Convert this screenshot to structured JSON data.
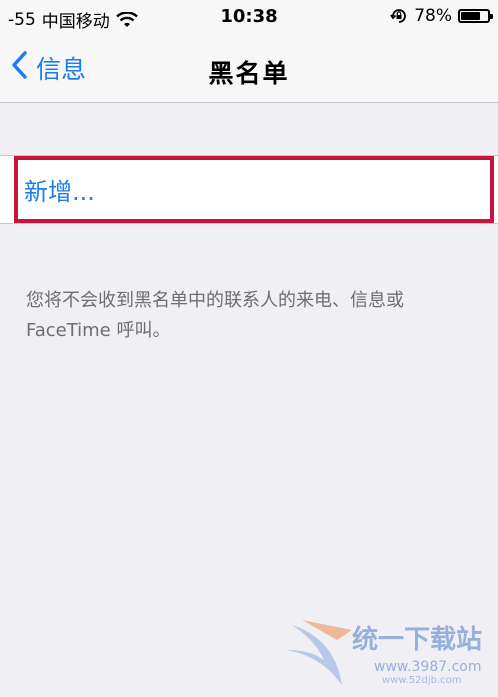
{
  "status_bar": {
    "signal": "-55",
    "carrier": "中国移动",
    "time": "10:38",
    "battery_percent": "78%",
    "battery_level": 0.78,
    "icons": [
      "wifi-icon",
      "rotation-lock-icon",
      "battery-icon"
    ]
  },
  "nav": {
    "back_label": "信息",
    "title": "黑名单",
    "accent_color": "#1a7cf2"
  },
  "list": {
    "add_label": "新增..."
  },
  "footer": {
    "note": "您将不会收到黑名单中的联系人的来电、信息或 FaceTime 呼叫。"
  },
  "watermark": {
    "brand": "统一下载站",
    "url": "www.3987.com",
    "url2": "www.52djb.com"
  }
}
